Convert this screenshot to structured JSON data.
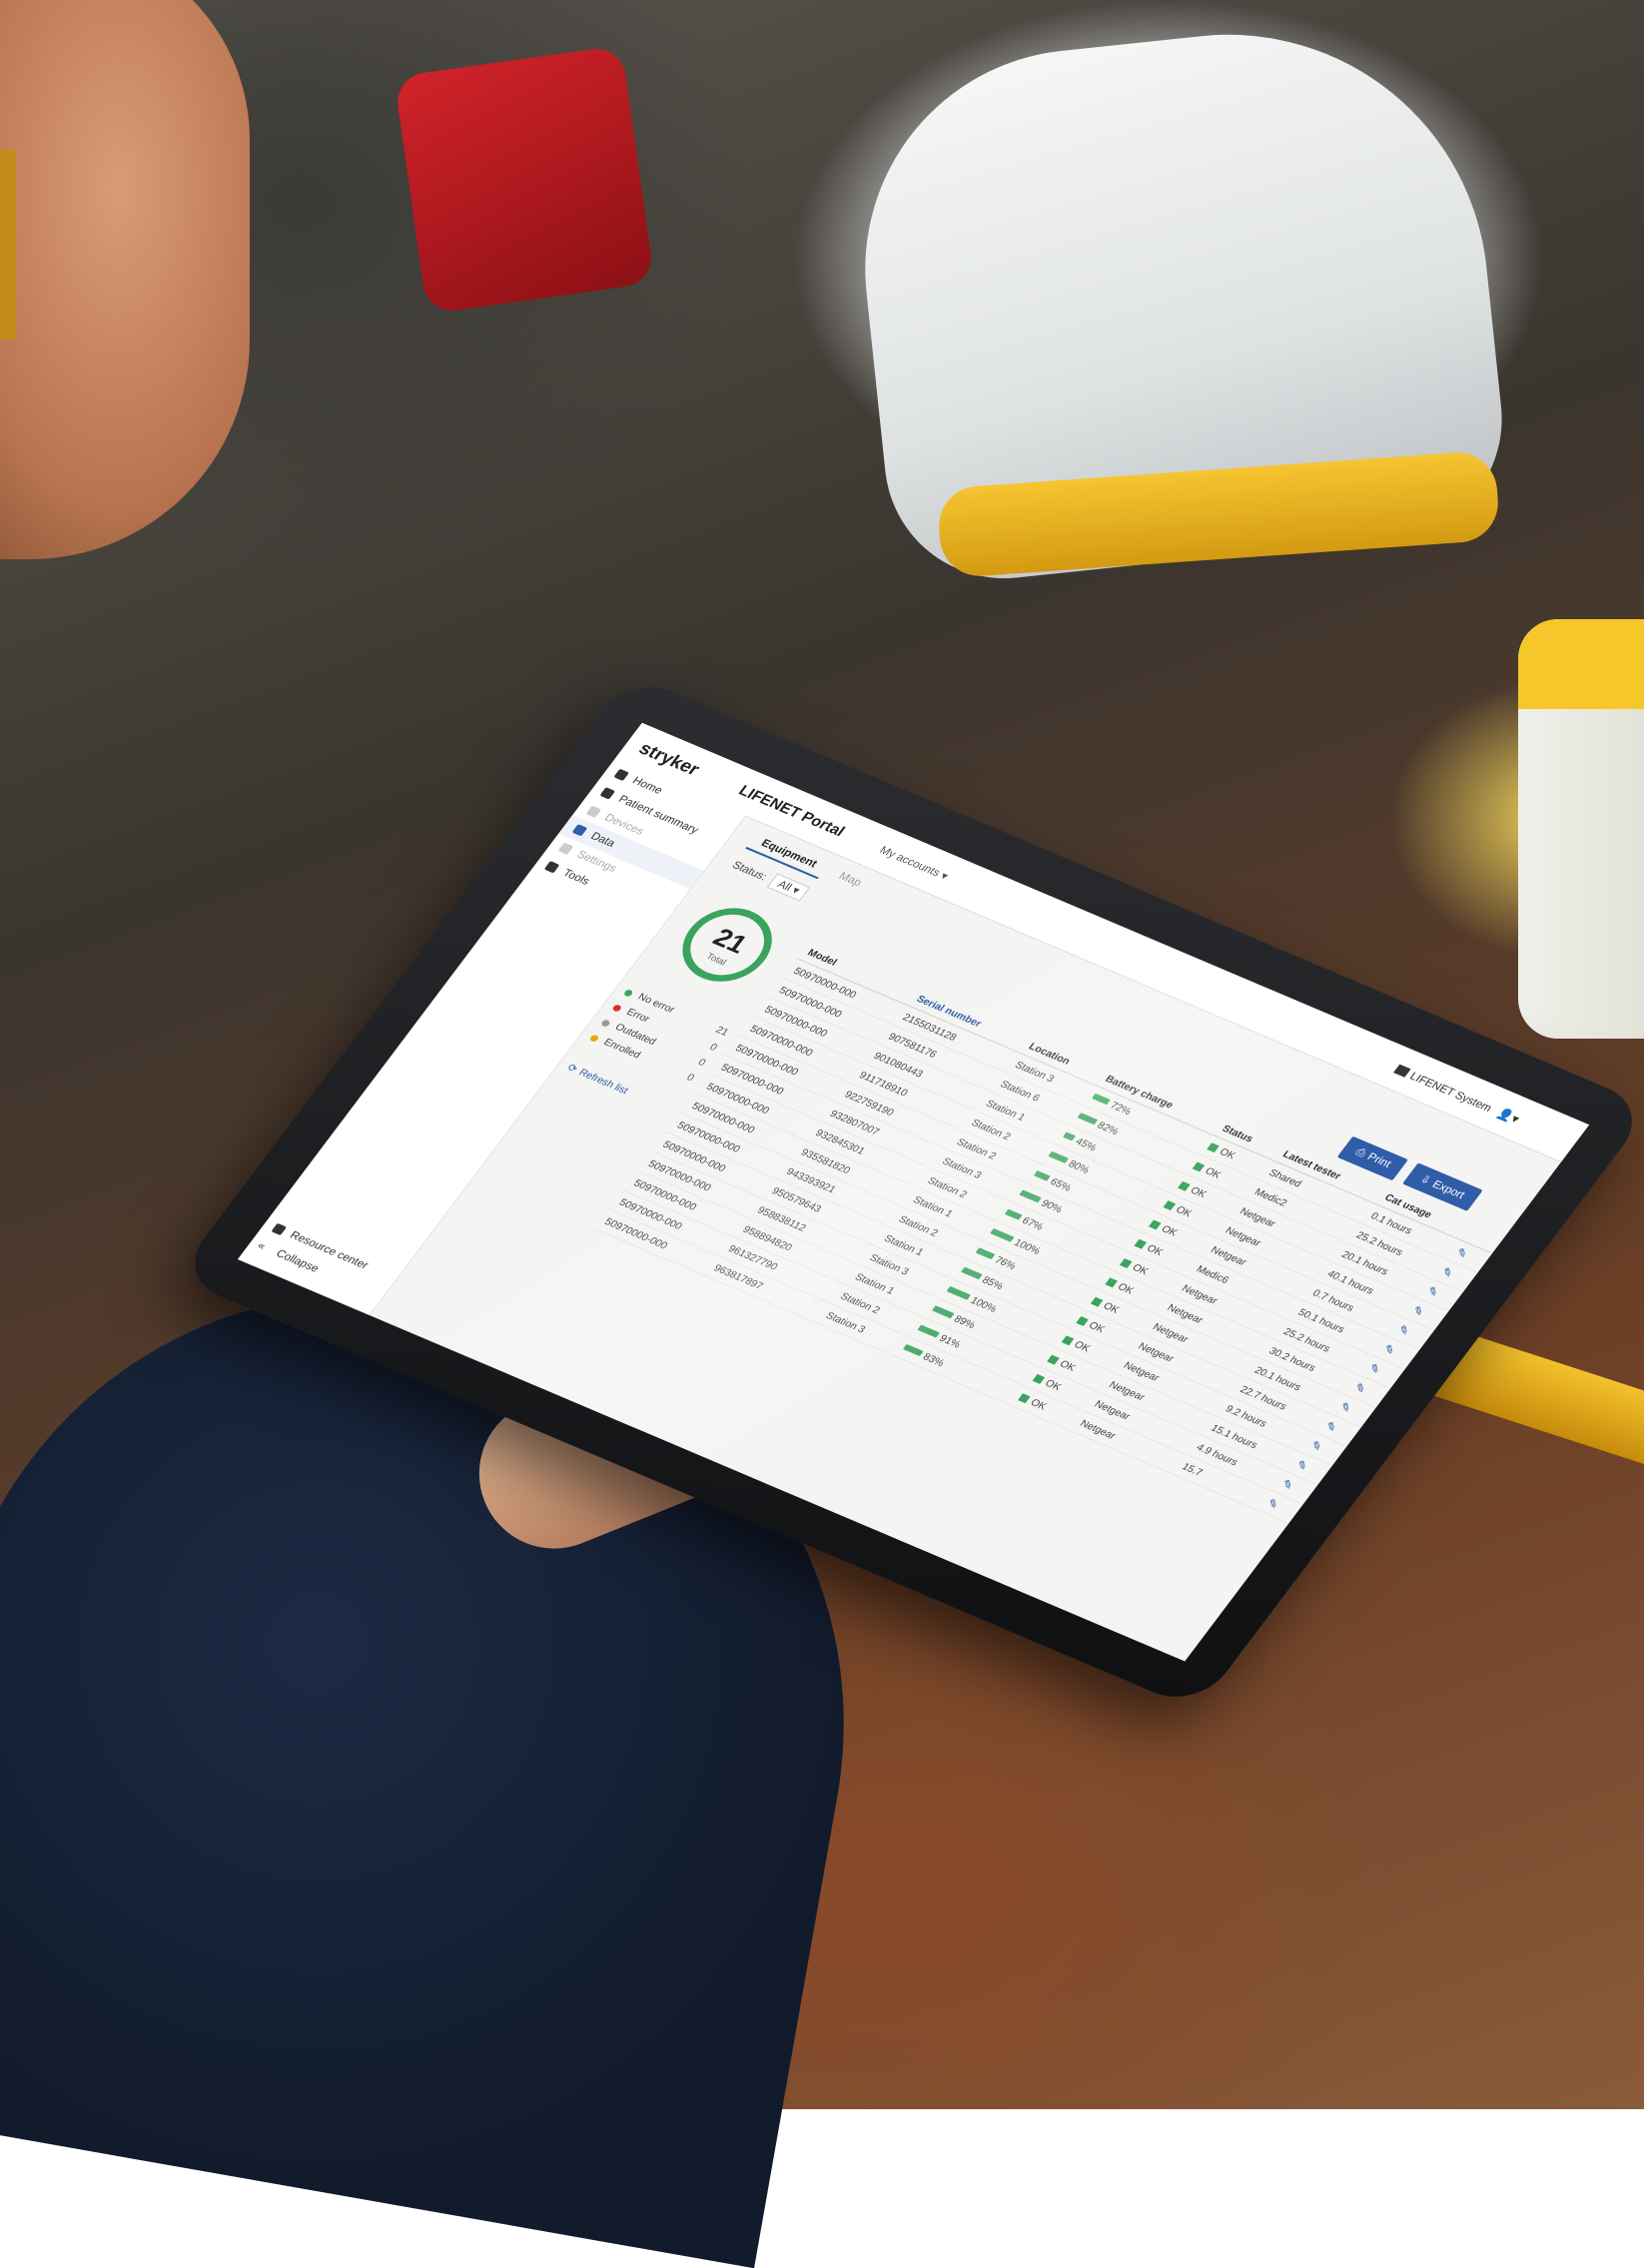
{
  "header": {
    "brand": "stryker",
    "portal_title": "LIFENET Portal",
    "accounts_label": "My accounts",
    "system_label": "LIFENET System",
    "user_icon": "user-icon"
  },
  "sidebar": {
    "items": [
      {
        "label": "Home",
        "icon": "home-icon",
        "state": "normal"
      },
      {
        "label": "Patient summary",
        "icon": "document-icon",
        "state": "normal"
      },
      {
        "label": "Devices",
        "icon": "",
        "state": "muted"
      },
      {
        "label": "Data",
        "icon": "data-icon",
        "state": "active"
      },
      {
        "label": "Settings",
        "icon": "",
        "state": "muted"
      },
      {
        "label": "Tools",
        "icon": "tools-icon",
        "state": "normal"
      }
    ],
    "resource_center": "Resource center",
    "collapse": "Collapse"
  },
  "tabs": [
    {
      "label": "Equipment",
      "active": true
    },
    {
      "label": "Map",
      "active": false
    }
  ],
  "status_filter": {
    "label": "Status",
    "value": "All"
  },
  "summary": {
    "count": "21",
    "unit": "Total",
    "ring_color": "#3aa45e",
    "legend": [
      {
        "label": "No error",
        "color": "#3aa45e",
        "count": "21"
      },
      {
        "label": "Error",
        "color": "#d9302c",
        "count": "0"
      },
      {
        "label": "Outdated",
        "color": "#9a9a9a",
        "count": "0"
      },
      {
        "label": "Enrolled",
        "color": "#e6a817",
        "count": "0"
      }
    ],
    "refresh": "Refresh list"
  },
  "actions": {
    "print": "Print",
    "export": "Export"
  },
  "table": {
    "columns": [
      "Model",
      "Serial number",
      "Location",
      "Battery charge",
      "Status",
      "Latest tester",
      "Cat usage",
      ""
    ],
    "rows": [
      {
        "model": "50970000-000",
        "serial": "2155031128",
        "location": "Station 3",
        "battery": "72%",
        "status": "OK",
        "tester": "Shared",
        "usage": "0.1 hours"
      },
      {
        "model": "50970000-000",
        "serial": "907581176",
        "location": "Station 6",
        "battery": "82%",
        "status": "OK",
        "tester": "Medic2",
        "usage": "25.2 hours"
      },
      {
        "model": "50970000-000",
        "serial": "901080443",
        "location": "Station 1",
        "battery": "45%",
        "status": "OK",
        "tester": "Netgear",
        "usage": "20.1 hours"
      },
      {
        "model": "50970000-000",
        "serial": "911718910",
        "location": "Station 2",
        "battery": "80%",
        "status": "OK",
        "tester": "Netgear",
        "usage": "40.1 hours"
      },
      {
        "model": "50970000-000",
        "serial": "922759190",
        "location": "Station 2",
        "battery": "65%",
        "status": "OK",
        "tester": "Netgear",
        "usage": "0.7 hours"
      },
      {
        "model": "50970000-000",
        "serial": "932807007",
        "location": "Station 3",
        "battery": "90%",
        "status": "OK",
        "tester": "Medic6",
        "usage": "50.1 hours"
      },
      {
        "model": "50970000-000",
        "serial": "932845301",
        "location": "Station 2",
        "battery": "67%",
        "status": "OK",
        "tester": "Netgear",
        "usage": "25.2 hours"
      },
      {
        "model": "50970000-000",
        "serial": "935581820",
        "location": "Station 1",
        "battery": "100%",
        "status": "OK",
        "tester": "Netgear",
        "usage": "30.2 hours"
      },
      {
        "model": "50970000-000",
        "serial": "943393921",
        "location": "Station 2",
        "battery": "76%",
        "status": "OK",
        "tester": "Netgear",
        "usage": "20.1 hours"
      },
      {
        "model": "50970000-000",
        "serial": "950579643",
        "location": "Station 1",
        "battery": "85%",
        "status": "OK",
        "tester": "Netgear",
        "usage": "22.7 hours"
      },
      {
        "model": "50970000-000",
        "serial": "958838112",
        "location": "Station 3",
        "battery": "100%",
        "status": "OK",
        "tester": "Netgear",
        "usage": "9.2 hours"
      },
      {
        "model": "50970000-000",
        "serial": "958894820",
        "location": "Station 1",
        "battery": "89%",
        "status": "OK",
        "tester": "Netgear",
        "usage": "15.1 hours"
      },
      {
        "model": "50970000-000",
        "serial": "961327790",
        "location": "Station 2",
        "battery": "91%",
        "status": "OK",
        "tester": "Netgear",
        "usage": "4.9 hours"
      },
      {
        "model": "50970000-000",
        "serial": "963817897",
        "location": "Station 3",
        "battery": "83%",
        "status": "OK",
        "tester": "Netgear",
        "usage": "15.7"
      }
    ]
  }
}
